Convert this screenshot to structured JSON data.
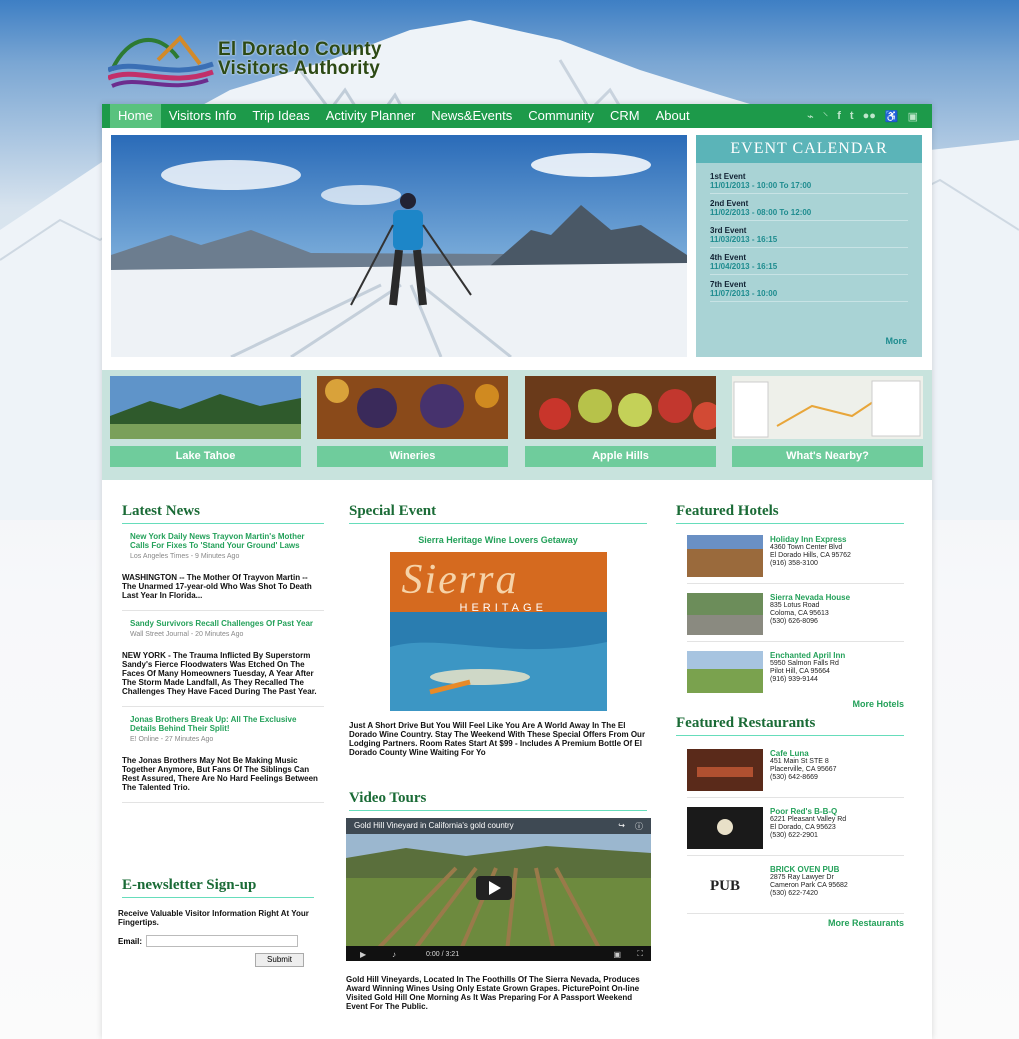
{
  "brand": {
    "line1": "El Dorado County",
    "line2": "Visitors Authority"
  },
  "nav": {
    "items": [
      "Home",
      "Visitors Info",
      "Trip Ideas",
      "Activity Planner",
      "News&Events",
      "Community",
      "CRM",
      "About"
    ],
    "icons": [
      "rss-icon",
      "share-icon",
      "facebook-icon",
      "twitter-icon",
      "flickr-icon",
      "accessibility-icon",
      "calendar-icon"
    ]
  },
  "calendar": {
    "title": "EVENT CALENDAR",
    "events": [
      {
        "name": "1st Event",
        "date": "11/01/2013 - 10:00 To 17:00"
      },
      {
        "name": "2nd Event",
        "date": "11/02/2013 - 08:00 To 12:00"
      },
      {
        "name": "3rd Event",
        "date": "11/03/2013 - 16:15"
      },
      {
        "name": "4th Event",
        "date": "11/04/2013 - 16:15"
      },
      {
        "name": "7th Event",
        "date": "11/07/2013 - 10:00"
      }
    ],
    "more": "More"
  },
  "tiles": [
    "Lake Tahoe",
    "Wineries",
    "Apple Hills",
    "What's Nearby?"
  ],
  "latest_news": {
    "title": "Latest News",
    "items": [
      {
        "title": "New York Daily News Trayvon Martin's Mother Calls For Fixes To 'Stand Your Ground' Laws",
        "source": "Los Angeles Times - 9 Minutes Ago",
        "body": "WASHINGTON -- The Mother Of Trayvon Martin -- The Unarmed 17-year-old Who Was Shot To Death Last Year In Florida..."
      },
      {
        "title": "Sandy Survivors Recall Challenges Of Past Year",
        "source": "Wall Street Journal - 20 Minutes Ago",
        "body": "NEW YORK - The Trauma Inflicted By Superstorm Sandy's Fierce Floodwaters Was Etched On The Faces Of Many Homeowners Tuesday, A Year After The Storm Made Landfall, As They Recalled The Challenges They Have Faced During The Past Year."
      },
      {
        "title": "Jonas Brothers Break Up: All The Exclusive Details Behind Their Split!",
        "source": "E! Online - 27 Minutes Ago",
        "body": "The Jonas Brothers May Not Be Making Music Together Anymore, But Fans Of The Siblings Can Rest Assured, There Are No Hard Feelings Between The Talented Trio."
      }
    ]
  },
  "newsletter": {
    "title": "E-newsletter Sign-up",
    "text": "Receive Valuable Visitor Information Right At Your Fingertips.",
    "email_label": "Email:",
    "email_value": "",
    "submit": "Submit"
  },
  "special_event": {
    "title": "Special Event",
    "subtitle": "Sierra Heritage Wine Lovers Getaway",
    "magazine_word": "Sierra",
    "magazine_sub": "HERITAGE",
    "body": "Just A Short Drive But You Will Feel Like You Are A World Away In The El Dorado Wine Country. Stay The Weekend With These Special Offers From Our Lodging Partners. Room Rates Start At $99 - Includes A Premium Bottle Of El Dorado County Wine Waiting For Yo"
  },
  "video_tours": {
    "title": "Video Tours",
    "video_title": "Gold Hill Vineyard in California's gold country",
    "time": "0:00 / 3:21",
    "body": "Gold Hill Vineyards, Located In The Foothills Of The Sierra Nevada, Produces Award Winning Wines Using Only Estate Grown Grapes. PicturePoint On-line Visited Gold Hill One Morning As It Was Preparing For A Passport Weekend Event For The Public."
  },
  "hotels": {
    "title": "Featured Hotels",
    "items": [
      {
        "name": "Holiday Inn Express",
        "l1": "4360 Town Center Blvd",
        "l2": "El Dorado Hills, CA 95762",
        "l3": "(916) 358-3100"
      },
      {
        "name": "Sierra Nevada House",
        "l1": "835 Lotus Road",
        "l2": "Coloma, CA 95613",
        "l3": "(530) 626-8096"
      },
      {
        "name": "Enchanted April Inn",
        "l1": "5950 Salmon Falls Rd",
        "l2": "Pilot Hill, CA 95664",
        "l3": "(916) 939-9144"
      }
    ],
    "more": "More Hotels"
  },
  "restaurants": {
    "title": "Featured Restaurants",
    "items": [
      {
        "name": "Cafe Luna",
        "l1": "451 Main St STE 8",
        "l2": "Placerville, CA 95667",
        "l3": "(530) 642-8669"
      },
      {
        "name": "Poor Red's B-B-Q",
        "l1": "6221 Pleasant Valley Rd",
        "l2": "El Dorado, CA 95623",
        "l3": "(530) 622-2901"
      },
      {
        "name": "BRICK OVEN PUB",
        "l1": "2875 Ray Lawyer Dr",
        "l2": "Cameron Park CA 95682",
        "l3": "(530) 622-7420"
      }
    ],
    "more": "More Restaurants",
    "pub_logo": "PUB"
  }
}
